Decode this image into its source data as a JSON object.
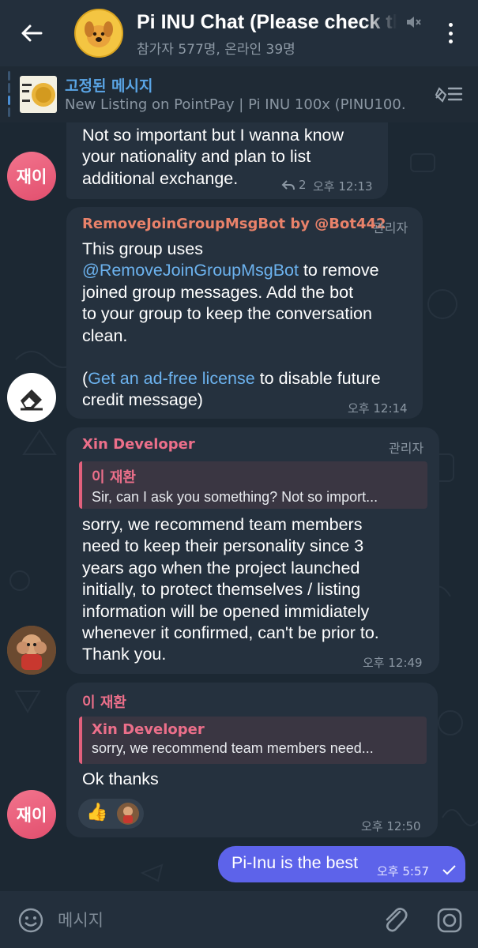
{
  "header": {
    "title": "Pi INU Chat (Please check the",
    "subtitle": "참가자 577명, 온라인 39명"
  },
  "pinned": {
    "title": "고정된 메시지",
    "text": "New Listing on PointPay | Pi INU 100x (PINU100..."
  },
  "messages": [
    {
      "avatar": "재이",
      "text_lines": [
        "Not so important but I wanna know",
        "your nationality and plan to list",
        "additional exchange."
      ],
      "reply_count": "2",
      "time": "오후 12:13"
    },
    {
      "sender": "RemoveJoinGroupMsgBot by @Bot442",
      "role": "관리자",
      "line1": "This group uses",
      "link_mention": "@RemoveJoinGroupMsgBot",
      "line2_rest": " to remove",
      "line3": "joined group messages. Add the bot",
      "line4": "to your group to keep the conversation",
      "line5": "clean.",
      "paren_open": "(",
      "link_license": "Get an ad-free license",
      "line6_rest": " to disable future",
      "line7": "credit message)",
      "time": "오후 12:14"
    },
    {
      "sender": "Xin Developer",
      "role": "관리자",
      "reply_name": "이 재환",
      "reply_text": "Sir, can I ask you something? Not so import...",
      "text_lines": [
        "sorry, we recommend team members",
        "need to keep their personality since 3",
        "years ago when the project launched",
        "initially, to protect themselves / listing",
        "information will be opened immidiately",
        "whenever it confirmed, can't be prior to.",
        "Thank you."
      ],
      "time": "오후 12:49"
    },
    {
      "sender": "이 재환",
      "avatar": "재이",
      "reply_name": "Xin Developer",
      "reply_text": "sorry, we recommend team members need...",
      "text": "Ok thanks",
      "reaction": "👍",
      "time": "오후 12:50"
    },
    {
      "text": "Pi-Inu is the best",
      "time": "오후 5:57"
    }
  ],
  "input": {
    "placeholder": "메시지"
  },
  "colors": {
    "accent_pink": "#ec6f8a",
    "bot_name": "#e9826a",
    "link_blue": "#6cb2ee",
    "outgoing_bubble": "#5d63ea",
    "incoming_bubble": "#25313e"
  },
  "icons": [
    "back-arrow-icon",
    "mute-icon",
    "more-vert-icon",
    "unpin-list-icon",
    "reply-arrow-icon",
    "emoji-icon",
    "attach-icon",
    "camera-icon",
    "double-check-icon"
  ]
}
